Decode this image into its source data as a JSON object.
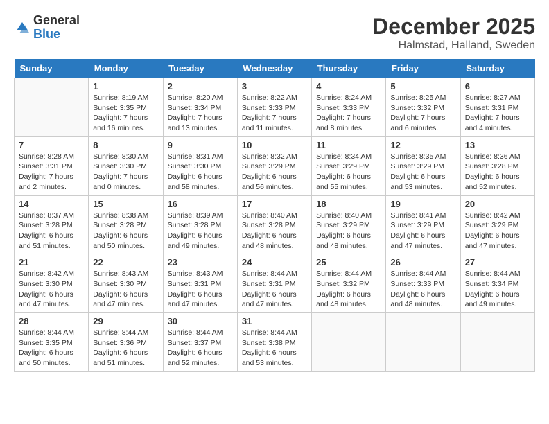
{
  "header": {
    "logo_general": "General",
    "logo_blue": "Blue",
    "month_year": "December 2025",
    "location": "Halmstad, Halland, Sweden"
  },
  "days_of_week": [
    "Sunday",
    "Monday",
    "Tuesday",
    "Wednesday",
    "Thursday",
    "Friday",
    "Saturday"
  ],
  "weeks": [
    [
      {
        "day": "",
        "info": ""
      },
      {
        "day": "1",
        "info": "Sunrise: 8:19 AM\nSunset: 3:35 PM\nDaylight: 7 hours\nand 16 minutes."
      },
      {
        "day": "2",
        "info": "Sunrise: 8:20 AM\nSunset: 3:34 PM\nDaylight: 7 hours\nand 13 minutes."
      },
      {
        "day": "3",
        "info": "Sunrise: 8:22 AM\nSunset: 3:33 PM\nDaylight: 7 hours\nand 11 minutes."
      },
      {
        "day": "4",
        "info": "Sunrise: 8:24 AM\nSunset: 3:33 PM\nDaylight: 7 hours\nand 8 minutes."
      },
      {
        "day": "5",
        "info": "Sunrise: 8:25 AM\nSunset: 3:32 PM\nDaylight: 7 hours\nand 6 minutes."
      },
      {
        "day": "6",
        "info": "Sunrise: 8:27 AM\nSunset: 3:31 PM\nDaylight: 7 hours\nand 4 minutes."
      }
    ],
    [
      {
        "day": "7",
        "info": "Sunrise: 8:28 AM\nSunset: 3:31 PM\nDaylight: 7 hours\nand 2 minutes."
      },
      {
        "day": "8",
        "info": "Sunrise: 8:30 AM\nSunset: 3:30 PM\nDaylight: 7 hours\nand 0 minutes."
      },
      {
        "day": "9",
        "info": "Sunrise: 8:31 AM\nSunset: 3:30 PM\nDaylight: 6 hours\nand 58 minutes."
      },
      {
        "day": "10",
        "info": "Sunrise: 8:32 AM\nSunset: 3:29 PM\nDaylight: 6 hours\nand 56 minutes."
      },
      {
        "day": "11",
        "info": "Sunrise: 8:34 AM\nSunset: 3:29 PM\nDaylight: 6 hours\nand 55 minutes."
      },
      {
        "day": "12",
        "info": "Sunrise: 8:35 AM\nSunset: 3:29 PM\nDaylight: 6 hours\nand 53 minutes."
      },
      {
        "day": "13",
        "info": "Sunrise: 8:36 AM\nSunset: 3:28 PM\nDaylight: 6 hours\nand 52 minutes."
      }
    ],
    [
      {
        "day": "14",
        "info": "Sunrise: 8:37 AM\nSunset: 3:28 PM\nDaylight: 6 hours\nand 51 minutes."
      },
      {
        "day": "15",
        "info": "Sunrise: 8:38 AM\nSunset: 3:28 PM\nDaylight: 6 hours\nand 50 minutes."
      },
      {
        "day": "16",
        "info": "Sunrise: 8:39 AM\nSunset: 3:28 PM\nDaylight: 6 hours\nand 49 minutes."
      },
      {
        "day": "17",
        "info": "Sunrise: 8:40 AM\nSunset: 3:28 PM\nDaylight: 6 hours\nand 48 minutes."
      },
      {
        "day": "18",
        "info": "Sunrise: 8:40 AM\nSunset: 3:29 PM\nDaylight: 6 hours\nand 48 minutes."
      },
      {
        "day": "19",
        "info": "Sunrise: 8:41 AM\nSunset: 3:29 PM\nDaylight: 6 hours\nand 47 minutes."
      },
      {
        "day": "20",
        "info": "Sunrise: 8:42 AM\nSunset: 3:29 PM\nDaylight: 6 hours\nand 47 minutes."
      }
    ],
    [
      {
        "day": "21",
        "info": "Sunrise: 8:42 AM\nSunset: 3:30 PM\nDaylight: 6 hours\nand 47 minutes."
      },
      {
        "day": "22",
        "info": "Sunrise: 8:43 AM\nSunset: 3:30 PM\nDaylight: 6 hours\nand 47 minutes."
      },
      {
        "day": "23",
        "info": "Sunrise: 8:43 AM\nSunset: 3:31 PM\nDaylight: 6 hours\nand 47 minutes."
      },
      {
        "day": "24",
        "info": "Sunrise: 8:44 AM\nSunset: 3:31 PM\nDaylight: 6 hours\nand 47 minutes."
      },
      {
        "day": "25",
        "info": "Sunrise: 8:44 AM\nSunset: 3:32 PM\nDaylight: 6 hours\nand 48 minutes."
      },
      {
        "day": "26",
        "info": "Sunrise: 8:44 AM\nSunset: 3:33 PM\nDaylight: 6 hours\nand 48 minutes."
      },
      {
        "day": "27",
        "info": "Sunrise: 8:44 AM\nSunset: 3:34 PM\nDaylight: 6 hours\nand 49 minutes."
      }
    ],
    [
      {
        "day": "28",
        "info": "Sunrise: 8:44 AM\nSunset: 3:35 PM\nDaylight: 6 hours\nand 50 minutes."
      },
      {
        "day": "29",
        "info": "Sunrise: 8:44 AM\nSunset: 3:36 PM\nDaylight: 6 hours\nand 51 minutes."
      },
      {
        "day": "30",
        "info": "Sunrise: 8:44 AM\nSunset: 3:37 PM\nDaylight: 6 hours\nand 52 minutes."
      },
      {
        "day": "31",
        "info": "Sunrise: 8:44 AM\nSunset: 3:38 PM\nDaylight: 6 hours\nand 53 minutes."
      },
      {
        "day": "",
        "info": ""
      },
      {
        "day": "",
        "info": ""
      },
      {
        "day": "",
        "info": ""
      }
    ]
  ]
}
